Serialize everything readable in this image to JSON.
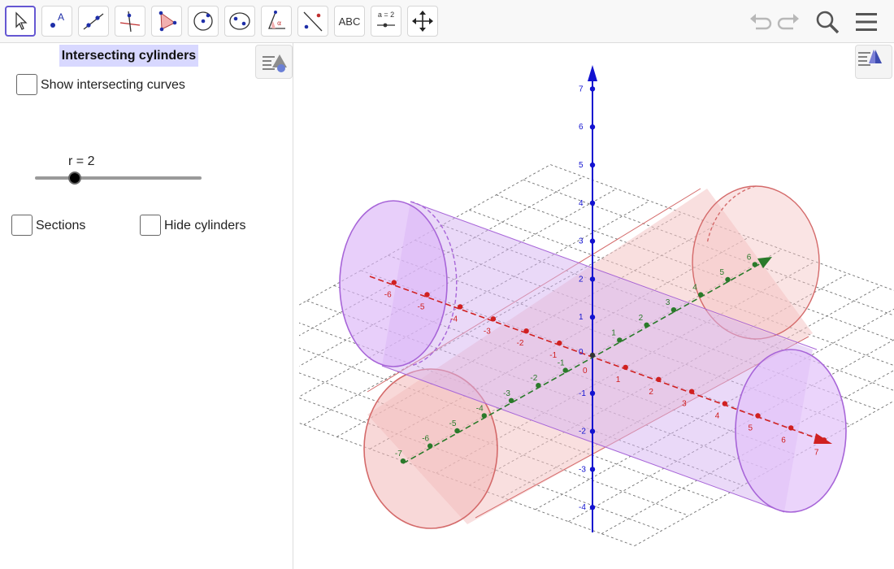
{
  "toolbar": {
    "tools": [
      {
        "name": "move-tool"
      },
      {
        "name": "point-tool",
        "label": "A"
      },
      {
        "name": "line-tool"
      },
      {
        "name": "perpendicular-line-tool"
      },
      {
        "name": "polygon-tool"
      },
      {
        "name": "circle-tool"
      },
      {
        "name": "conic-tool"
      },
      {
        "name": "angle-tool",
        "label": "α"
      },
      {
        "name": "reflect-tool"
      },
      {
        "name": "text-tool",
        "label": "ABC"
      },
      {
        "name": "slider-tool",
        "label": "a = 2"
      },
      {
        "name": "move-view-tool"
      }
    ],
    "icons": [
      "undo-icon",
      "redo-icon",
      "search-icon",
      "menu-icon"
    ]
  },
  "panel": {
    "title": "Intersecting cylinders",
    "show_curves_label": "Show intersecting curves",
    "slider_label": "r = 2",
    "slider_value": 2,
    "slider_fraction": 0.24,
    "sections_label": "Sections",
    "hide_cylinders_label": "Hide cylinders"
  },
  "axes": {
    "z_labels": [
      "7",
      "6",
      "5",
      "4",
      "3",
      "2",
      "1",
      "0",
      "-1",
      "-2",
      "-3",
      "-4"
    ],
    "x_labels": [
      "-6",
      "-5",
      "-4",
      "-3",
      "-2",
      "-1",
      "0",
      "1",
      "2",
      "3",
      "4",
      "5",
      "6",
      "7"
    ],
    "y_labels": [
      "-7",
      "-6",
      "-5",
      "-4",
      "-3",
      "-2",
      "-1",
      "1",
      "2",
      "3",
      "4",
      "5",
      "6"
    ]
  },
  "colors": {
    "accent": "#6557d2",
    "z_axis": "#1212d0",
    "x_axis": "#d02020",
    "y_axis": "#2a7a2a",
    "cyl_red": "#e8a0a0",
    "cyl_purple": "#c89ae8"
  }
}
